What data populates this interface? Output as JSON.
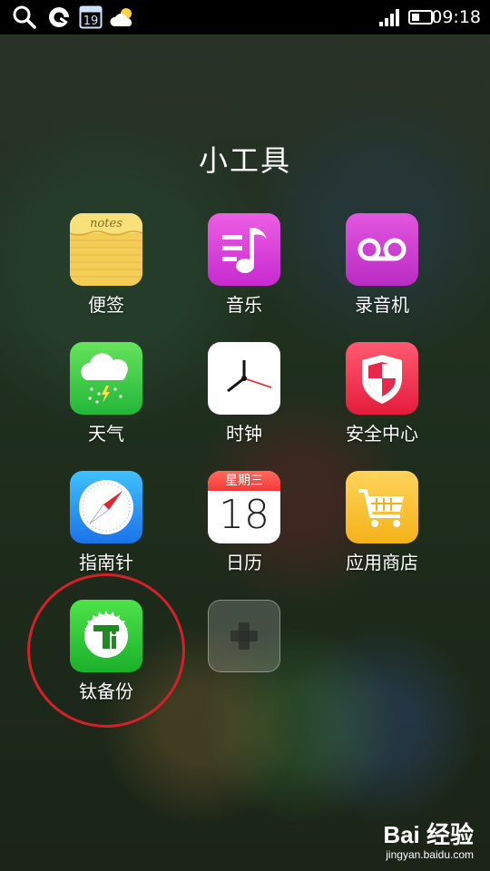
{
  "status_bar": {
    "left_icons": [
      "search-icon",
      "q-app-icon",
      "calendar-icon",
      "weather-icon"
    ],
    "calendar_day": "19",
    "time": "09:18",
    "right_icons": [
      "signal-icon",
      "battery-icon"
    ]
  },
  "folder": {
    "title": "小工具",
    "apps": [
      {
        "name": "notes",
        "label": "便签",
        "icon_text": "notes"
      },
      {
        "name": "music",
        "label": "音乐"
      },
      {
        "name": "recorder",
        "label": "录音机"
      },
      {
        "name": "weather",
        "label": "天气"
      },
      {
        "name": "clock",
        "label": "时钟"
      },
      {
        "name": "security",
        "label": "安全中心"
      },
      {
        "name": "compass",
        "label": "指南针"
      },
      {
        "name": "calendar",
        "label": "日历",
        "weekday": "星期三",
        "day": "18"
      },
      {
        "name": "app-store",
        "label": "应用商店"
      },
      {
        "name": "ti-backup",
        "label": "钛备份"
      },
      {
        "name": "add",
        "label": ""
      }
    ]
  },
  "watermark": {
    "brand": "Bai 经验",
    "url": "jingyan.baidu.com"
  },
  "colors": {
    "annotation_circle": "#d3202a"
  }
}
